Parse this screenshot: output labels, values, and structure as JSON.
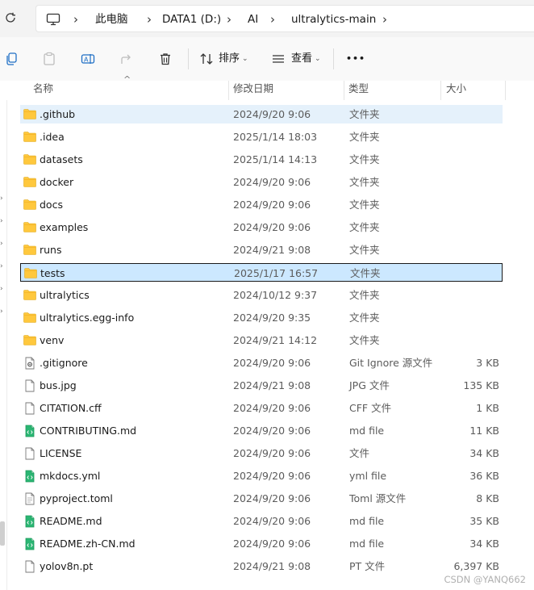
{
  "breadcrumb": [
    "此电脑",
    "DATA1 (D:)",
    "AI",
    "ultralytics-main"
  ],
  "toolbar": {
    "sort_label": "排序",
    "view_label": "查看",
    "more_label": "•••"
  },
  "columns": {
    "name": "名称",
    "date": "修改日期",
    "type": "类型",
    "size": "大小"
  },
  "files": [
    {
      "name": ".github",
      "date": "2024/9/20 9:06",
      "type": "文件夹",
      "size": "",
      "icon": "folder-icon"
    },
    {
      "name": ".idea",
      "date": "2025/1/14 18:03",
      "type": "文件夹",
      "size": "",
      "icon": "folder-icon"
    },
    {
      "name": "datasets",
      "date": "2025/1/14 14:13",
      "type": "文件夹",
      "size": "",
      "icon": "folder-icon"
    },
    {
      "name": "docker",
      "date": "2024/9/20 9:06",
      "type": "文件夹",
      "size": "",
      "icon": "folder-icon"
    },
    {
      "name": "docs",
      "date": "2024/9/20 9:06",
      "type": "文件夹",
      "size": "",
      "icon": "folder-icon"
    },
    {
      "name": "examples",
      "date": "2024/9/20 9:06",
      "type": "文件夹",
      "size": "",
      "icon": "folder-icon"
    },
    {
      "name": "runs",
      "date": "2024/9/21 9:08",
      "type": "文件夹",
      "size": "",
      "icon": "folder-icon"
    },
    {
      "name": "tests",
      "date": "2025/1/17 16:57",
      "type": "文件夹",
      "size": "",
      "icon": "folder-icon"
    },
    {
      "name": "ultralytics",
      "date": "2024/10/12 9:37",
      "type": "文件夹",
      "size": "",
      "icon": "folder-icon"
    },
    {
      "name": "ultralytics.egg-info",
      "date": "2024/9/20 9:35",
      "type": "文件夹",
      "size": "",
      "icon": "folder-icon"
    },
    {
      "name": "venv",
      "date": "2024/9/21 14:12",
      "type": "文件夹",
      "size": "",
      "icon": "folder-icon"
    },
    {
      "name": ".gitignore",
      "date": "2024/9/20 9:06",
      "type": "Git Ignore 源文件",
      "size": "3 KB",
      "icon": "gear-file-icon"
    },
    {
      "name": "bus.jpg",
      "date": "2024/9/21 9:08",
      "type": "JPG 文件",
      "size": "135 KB",
      "icon": "file-icon"
    },
    {
      "name": "CITATION.cff",
      "date": "2024/9/20 9:06",
      "type": "CFF 文件",
      "size": "1 KB",
      "icon": "file-icon"
    },
    {
      "name": "CONTRIBUTING.md",
      "date": "2024/9/20 9:06",
      "type": "md file",
      "size": "11 KB",
      "icon": "code-file-icon"
    },
    {
      "name": "LICENSE",
      "date": "2024/9/20 9:06",
      "type": "文件",
      "size": "34 KB",
      "icon": "file-icon"
    },
    {
      "name": "mkdocs.yml",
      "date": "2024/9/20 9:06",
      "type": "yml file",
      "size": "36 KB",
      "icon": "code-file-icon"
    },
    {
      "name": "pyproject.toml",
      "date": "2024/9/20 9:06",
      "type": "Toml 源文件",
      "size": "8 KB",
      "icon": "text-file-icon"
    },
    {
      "name": "README.md",
      "date": "2024/9/20 9:06",
      "type": "md file",
      "size": "35 KB",
      "icon": "code-file-icon"
    },
    {
      "name": "README.zh-CN.md",
      "date": "2024/9/20 9:06",
      "type": "md file",
      "size": "34 KB",
      "icon": "code-file-icon"
    },
    {
      "name": "yolov8n.pt",
      "date": "2024/9/21 9:08",
      "type": "PT 文件",
      "size": "6,397 KB",
      "icon": "file-icon"
    }
  ],
  "selection": {
    "hover_row": ".github",
    "selected_row": "tests"
  },
  "colors": {
    "folder": "#ffc83d",
    "code_badge": "#2bb673",
    "selected_bg": "#cce8ff",
    "hover_bg": "#e5f1fb"
  },
  "watermark": "CSDN @YANQ662"
}
